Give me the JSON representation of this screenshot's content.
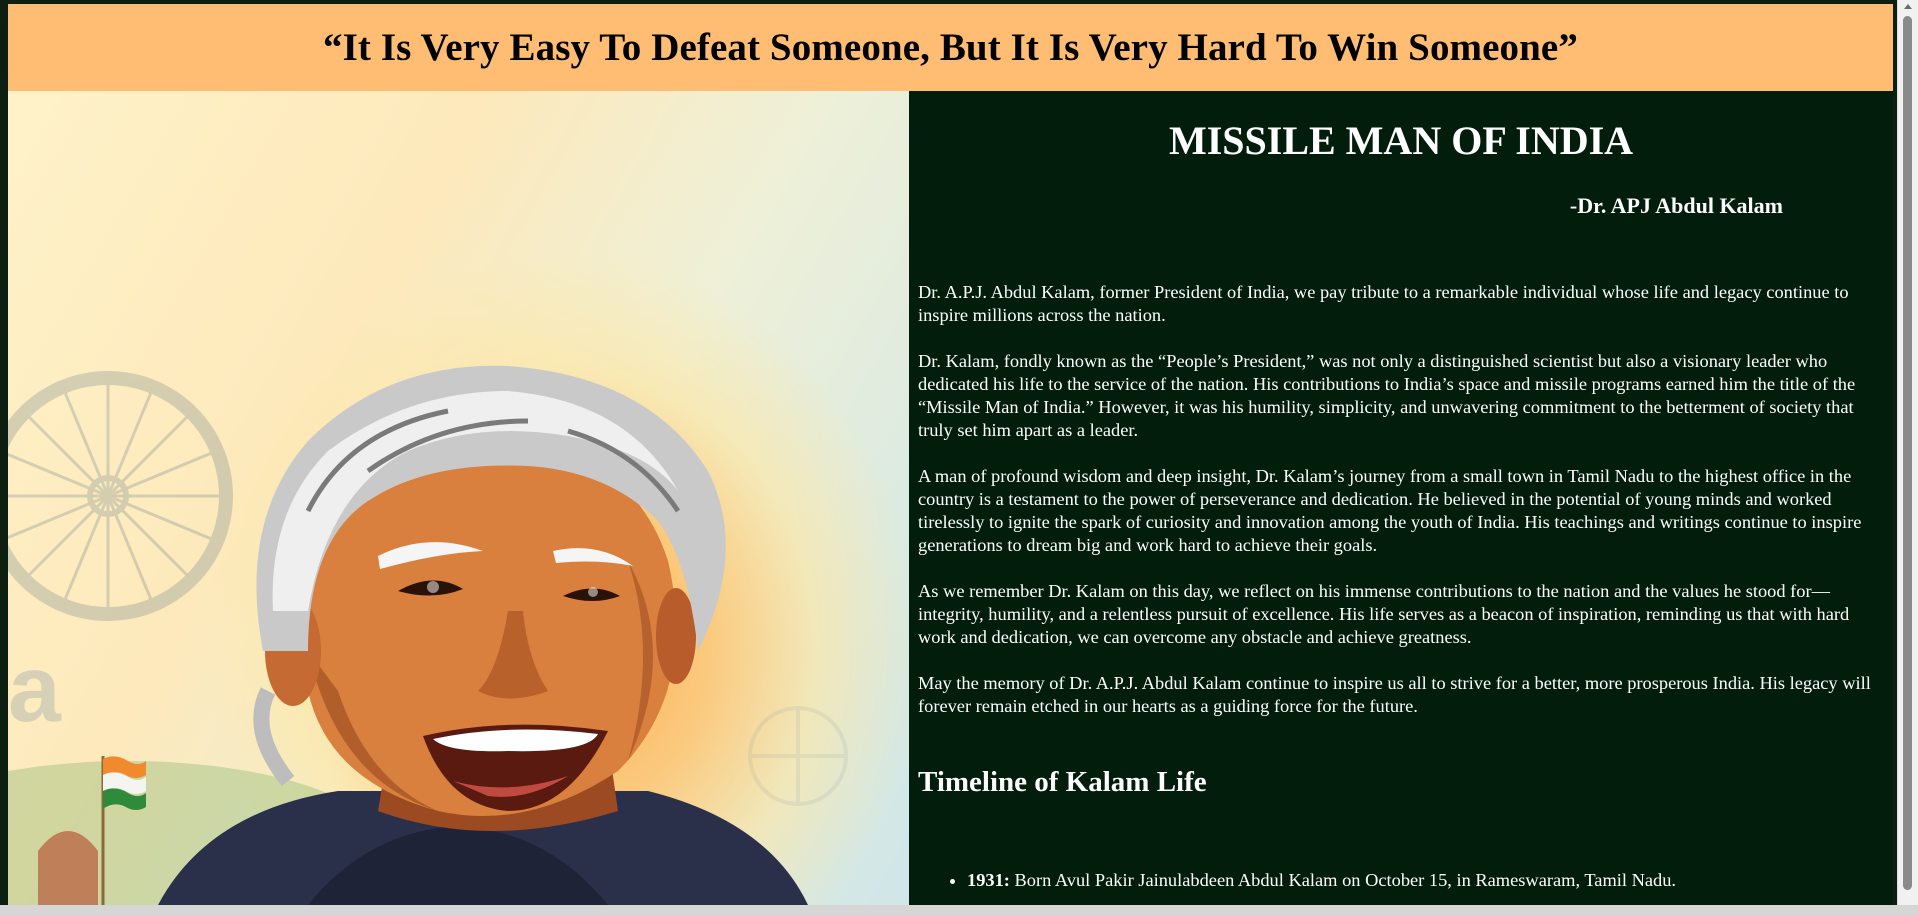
{
  "banner": {
    "quote": "“It Is Very Easy To Defeat Someone, But It Is Very Hard To Win Someone”",
    "background": "#ffbc73"
  },
  "portrait": {
    "description_icon": "portrait-illustration",
    "flag_icon": "indian-flag-icon",
    "chakra_icon": "ashoka-chakra-icon"
  },
  "content": {
    "title": "MISSILE MAN OF INDIA",
    "byline": "-Dr. APJ Abdul Kalam",
    "background": "#021d0b",
    "paragraphs": [
      "Dr. A.P.J. Abdul Kalam, former President of India, we pay tribute to a remarkable individual whose life and legacy continue to inspire millions across the nation.",
      "Dr. Kalam, fondly known as the “People’s President,” was not only a distinguished scientist but also a visionary leader who dedicated his life to the service of the nation. His contributions to India’s space and missile programs earned him the title of the “Missile Man of India.” However, it was his humility, simplicity, and unwavering commitment to the betterment of society that truly set him apart as a leader.",
      "A man of profound wisdom and deep insight, Dr. Kalam’s journey from a small town in Tamil Nadu to the highest office in the country is a testament to the power of perseverance and dedication. He believed in the potential of young minds and worked tirelessly to ignite the spark of curiosity and innovation among the youth of India. His teachings and writings continue to inspire generations to dream big and work hard to achieve their goals.",
      "As we remember Dr. Kalam on this day, we reflect on his immense contributions to the nation and the values he stood for—integrity, humility, and a relentless pursuit of excellence. His life serves as a beacon of inspiration, reminding us that with hard work and dedication, we can overcome any obstacle and achieve greatness.",
      "May the memory of Dr. A.P.J. Abdul Kalam continue to inspire us all to strive for a better, more prosperous India. His legacy will forever remain etched in our hearts as a guiding force for the future."
    ],
    "timeline_heading": "Timeline of Kalam Life",
    "timeline": [
      {
        "year": "1931:",
        "text": " Born Avul Pakir Jainulabdeen Abdul Kalam on October 15, in Rameswaram, Tamil Nadu."
      }
    ]
  }
}
